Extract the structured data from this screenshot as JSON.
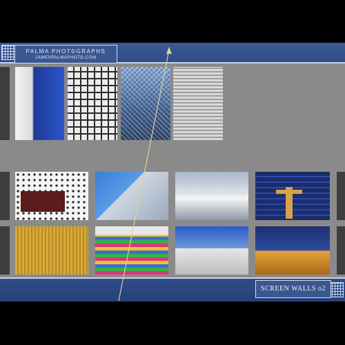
{
  "header": {
    "brand_name": "PALMA  PHOT©GRAPHS",
    "website": "JAMESPALMAPHOTO.COM"
  },
  "caption": {
    "title": "SCREEN WALLS  o2"
  },
  "icons": {
    "top_left": "grid-icon",
    "bottom_right": "grid-icon"
  },
  "colors": {
    "band": "#2f4c86",
    "panel": "#8a8a8a",
    "background": "#000000",
    "accent_line": "#e0d38a"
  },
  "gallery": {
    "rows": [
      {
        "name": "row-1",
        "items": [
          "photo-curved-facade",
          "photo-grid-screen",
          "photo-perforated-tower",
          "photo-louvered-wall"
        ]
      },
      {
        "name": "row-2",
        "items": [
          "photo-floral-screen",
          "photo-glass-building",
          "photo-dome-reflection",
          "photo-figure-stained-glass"
        ]
      },
      {
        "name": "row-3",
        "items": [
          "photo-gold-screen",
          "photo-color-stripes",
          "photo-white-lattice",
          "photo-blue-gold-tower"
        ]
      }
    ]
  }
}
